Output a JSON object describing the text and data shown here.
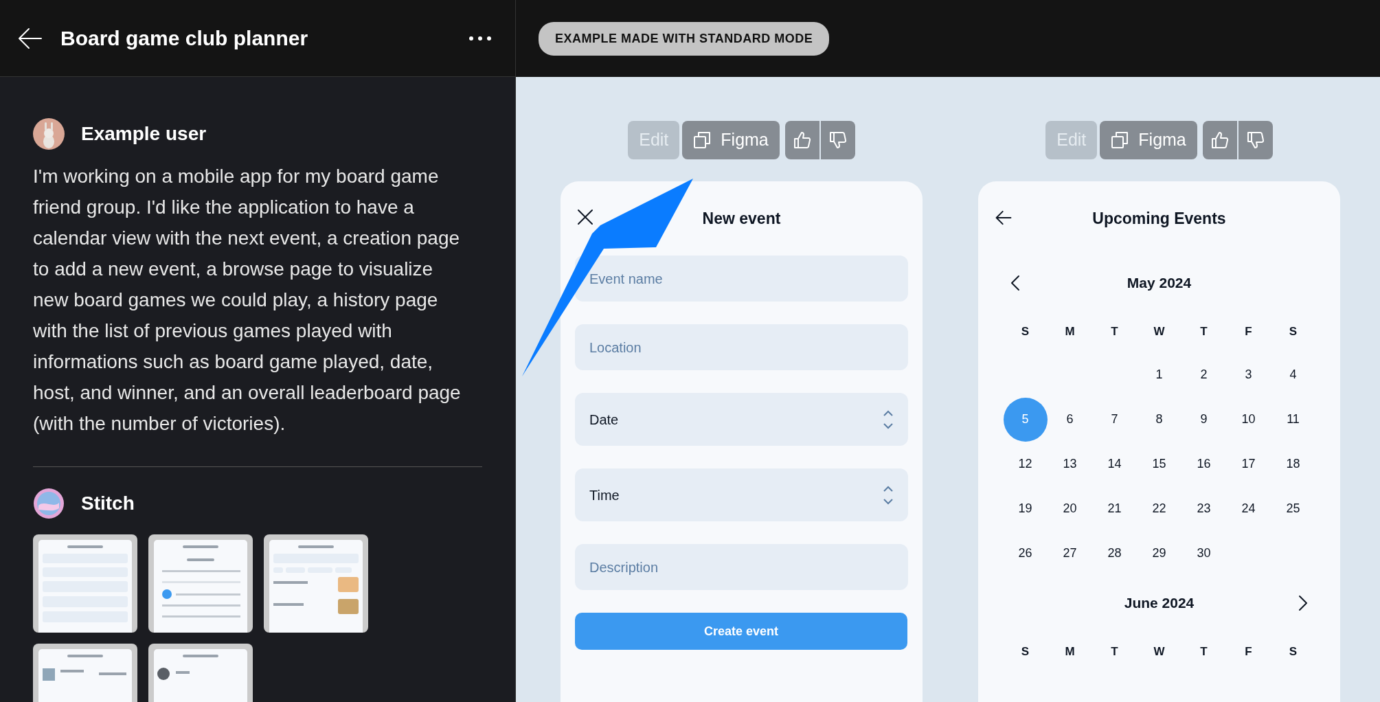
{
  "header": {
    "title": "Board game club planner"
  },
  "prompt": {
    "user": "Example user",
    "text": "I'm working on a mobile app for my board game friend group. I'd like the application to have a calendar view with the next event, a creation page to add a new event, a browse page to visualize new board games we could play, a history page with the list of previous games played with informations such as board game played, date, host, and winner, and an overall leaderboard page (with the number of victories)."
  },
  "response": {
    "author": "Stitch"
  },
  "badge": "EXAMPLE MADE WITH STANDARD MODE",
  "previews": [
    {
      "toolbar": [
        {
          "label": "Edit",
          "disabled": true
        },
        {
          "label": "Figma",
          "disabled": false
        }
      ],
      "screen": {
        "kind": "form",
        "title": "New event",
        "header_button": {
          "kind": "close"
        },
        "fields": [
          {
            "kind": "text",
            "placeholder": "Event name"
          },
          {
            "kind": "text",
            "placeholder": "Location"
          },
          {
            "kind": "select",
            "value": "Date"
          },
          {
            "kind": "select",
            "value": "Time"
          },
          {
            "kind": "text",
            "placeholder": "Description"
          }
        ],
        "submit": "Create event"
      }
    },
    {
      "toolbar": [
        {
          "label": "Edit",
          "disabled": true
        },
        {
          "label": "Figma",
          "disabled": false
        }
      ],
      "screen": {
        "kind": "calendar",
        "title": "Upcoming Events",
        "header_button": {
          "kind": "back"
        },
        "months": [
          {
            "title": "May 2024",
            "nav": {
              "kind": "prev"
            },
            "weekdays": [
              "S",
              "M",
              "T",
              "W",
              "T",
              "F",
              "S"
            ],
            "weeks": [
              [
                {
                  "kind": "blank"
                },
                {
                  "kind": "blank"
                },
                {
                  "kind": "blank"
                },
                {
                  "kind": "day",
                  "day": "1",
                  "selected": false
                },
                {
                  "kind": "day",
                  "day": "2",
                  "selected": false
                },
                {
                  "kind": "day",
                  "day": "3",
                  "selected": false
                },
                {
                  "kind": "day",
                  "day": "4",
                  "selected": false
                }
              ],
              [
                {
                  "kind": "day",
                  "day": "5",
                  "selected": true
                },
                {
                  "kind": "day",
                  "day": "6",
                  "selected": false
                },
                {
                  "kind": "day",
                  "day": "7",
                  "selected": false
                },
                {
                  "kind": "day",
                  "day": "8",
                  "selected": false
                },
                {
                  "kind": "day",
                  "day": "9",
                  "selected": false
                },
                {
                  "kind": "day",
                  "day": "10",
                  "selected": false
                },
                {
                  "kind": "day",
                  "day": "11",
                  "selected": false
                }
              ],
              [
                {
                  "kind": "day",
                  "day": "12",
                  "selected": false
                },
                {
                  "kind": "day",
                  "day": "13",
                  "selected": false
                },
                {
                  "kind": "day",
                  "day": "14",
                  "selected": false
                },
                {
                  "kind": "day",
                  "day": "15",
                  "selected": false
                },
                {
                  "kind": "day",
                  "day": "16",
                  "selected": false
                },
                {
                  "kind": "day",
                  "day": "17",
                  "selected": false
                },
                {
                  "kind": "day",
                  "day": "18",
                  "selected": false
                }
              ],
              [
                {
                  "kind": "day",
                  "day": "19",
                  "selected": false
                },
                {
                  "kind": "day",
                  "day": "20",
                  "selected": false
                },
                {
                  "kind": "day",
                  "day": "21",
                  "selected": false
                },
                {
                  "kind": "day",
                  "day": "22",
                  "selected": false
                },
                {
                  "kind": "day",
                  "day": "23",
                  "selected": false
                },
                {
                  "kind": "day",
                  "day": "24",
                  "selected": false
                },
                {
                  "kind": "day",
                  "day": "25",
                  "selected": false
                }
              ],
              [
                {
                  "kind": "day",
                  "day": "26",
                  "selected": false
                },
                {
                  "kind": "day",
                  "day": "27",
                  "selected": false
                },
                {
                  "kind": "day",
                  "day": "28",
                  "selected": false
                },
                {
                  "kind": "day",
                  "day": "29",
                  "selected": false
                },
                {
                  "kind": "day",
                  "day": "30",
                  "selected": false
                }
              ]
            ]
          },
          {
            "title": "June 2024",
            "nav": {
              "kind": "next"
            },
            "weekdays": [
              "S",
              "M",
              "T",
              "W",
              "T",
              "F",
              "S"
            ]
          }
        ]
      }
    }
  ]
}
